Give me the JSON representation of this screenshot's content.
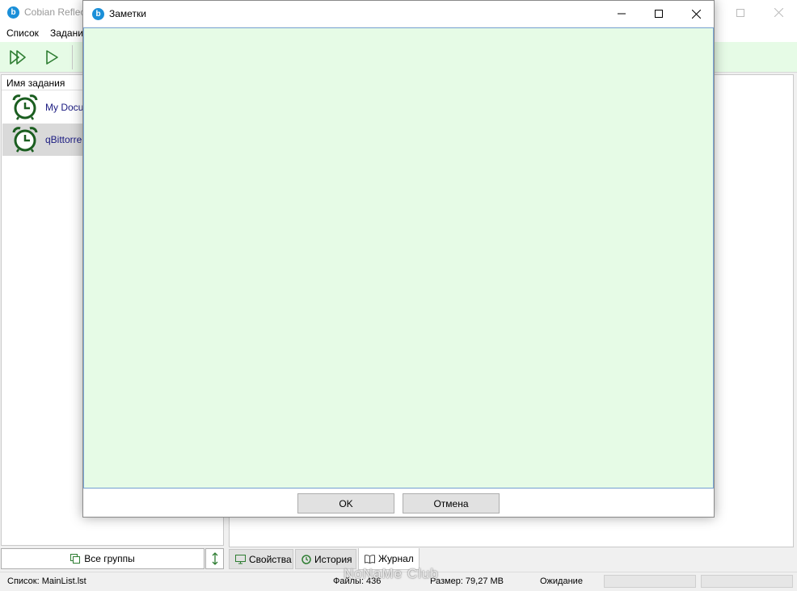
{
  "main_window": {
    "title": "Cobian Reflec",
    "app_icon": "cobian-app-icon",
    "menu": [
      "Список",
      "Задани"
    ],
    "toolbar": {
      "icons": [
        "run-all-icon",
        "run-icon"
      ],
      "accent_color": "#2e7d32",
      "background_color": "#e6fbe6"
    },
    "task_list": {
      "header": "Имя задания",
      "tasks": [
        {
          "name": "My Docu",
          "icon": "alarm-clock-icon"
        },
        {
          "name": "qBittorre",
          "icon": "alarm-clock-icon"
        }
      ]
    },
    "groups_button": "Все группы",
    "tabs": [
      "Свойства",
      "История",
      "Журнал"
    ],
    "status": {
      "list": "Список: MainList.lst",
      "files": "Файлы: 436",
      "size": "Размер: 79,27 MB",
      "state": "Ожидание"
    },
    "watermark": "NoNaMe Club"
  },
  "notes_dialog": {
    "title": "Заметки",
    "text": "",
    "ok": "OK",
    "cancel": "Отмена",
    "text_background": "#e6fbe6"
  }
}
